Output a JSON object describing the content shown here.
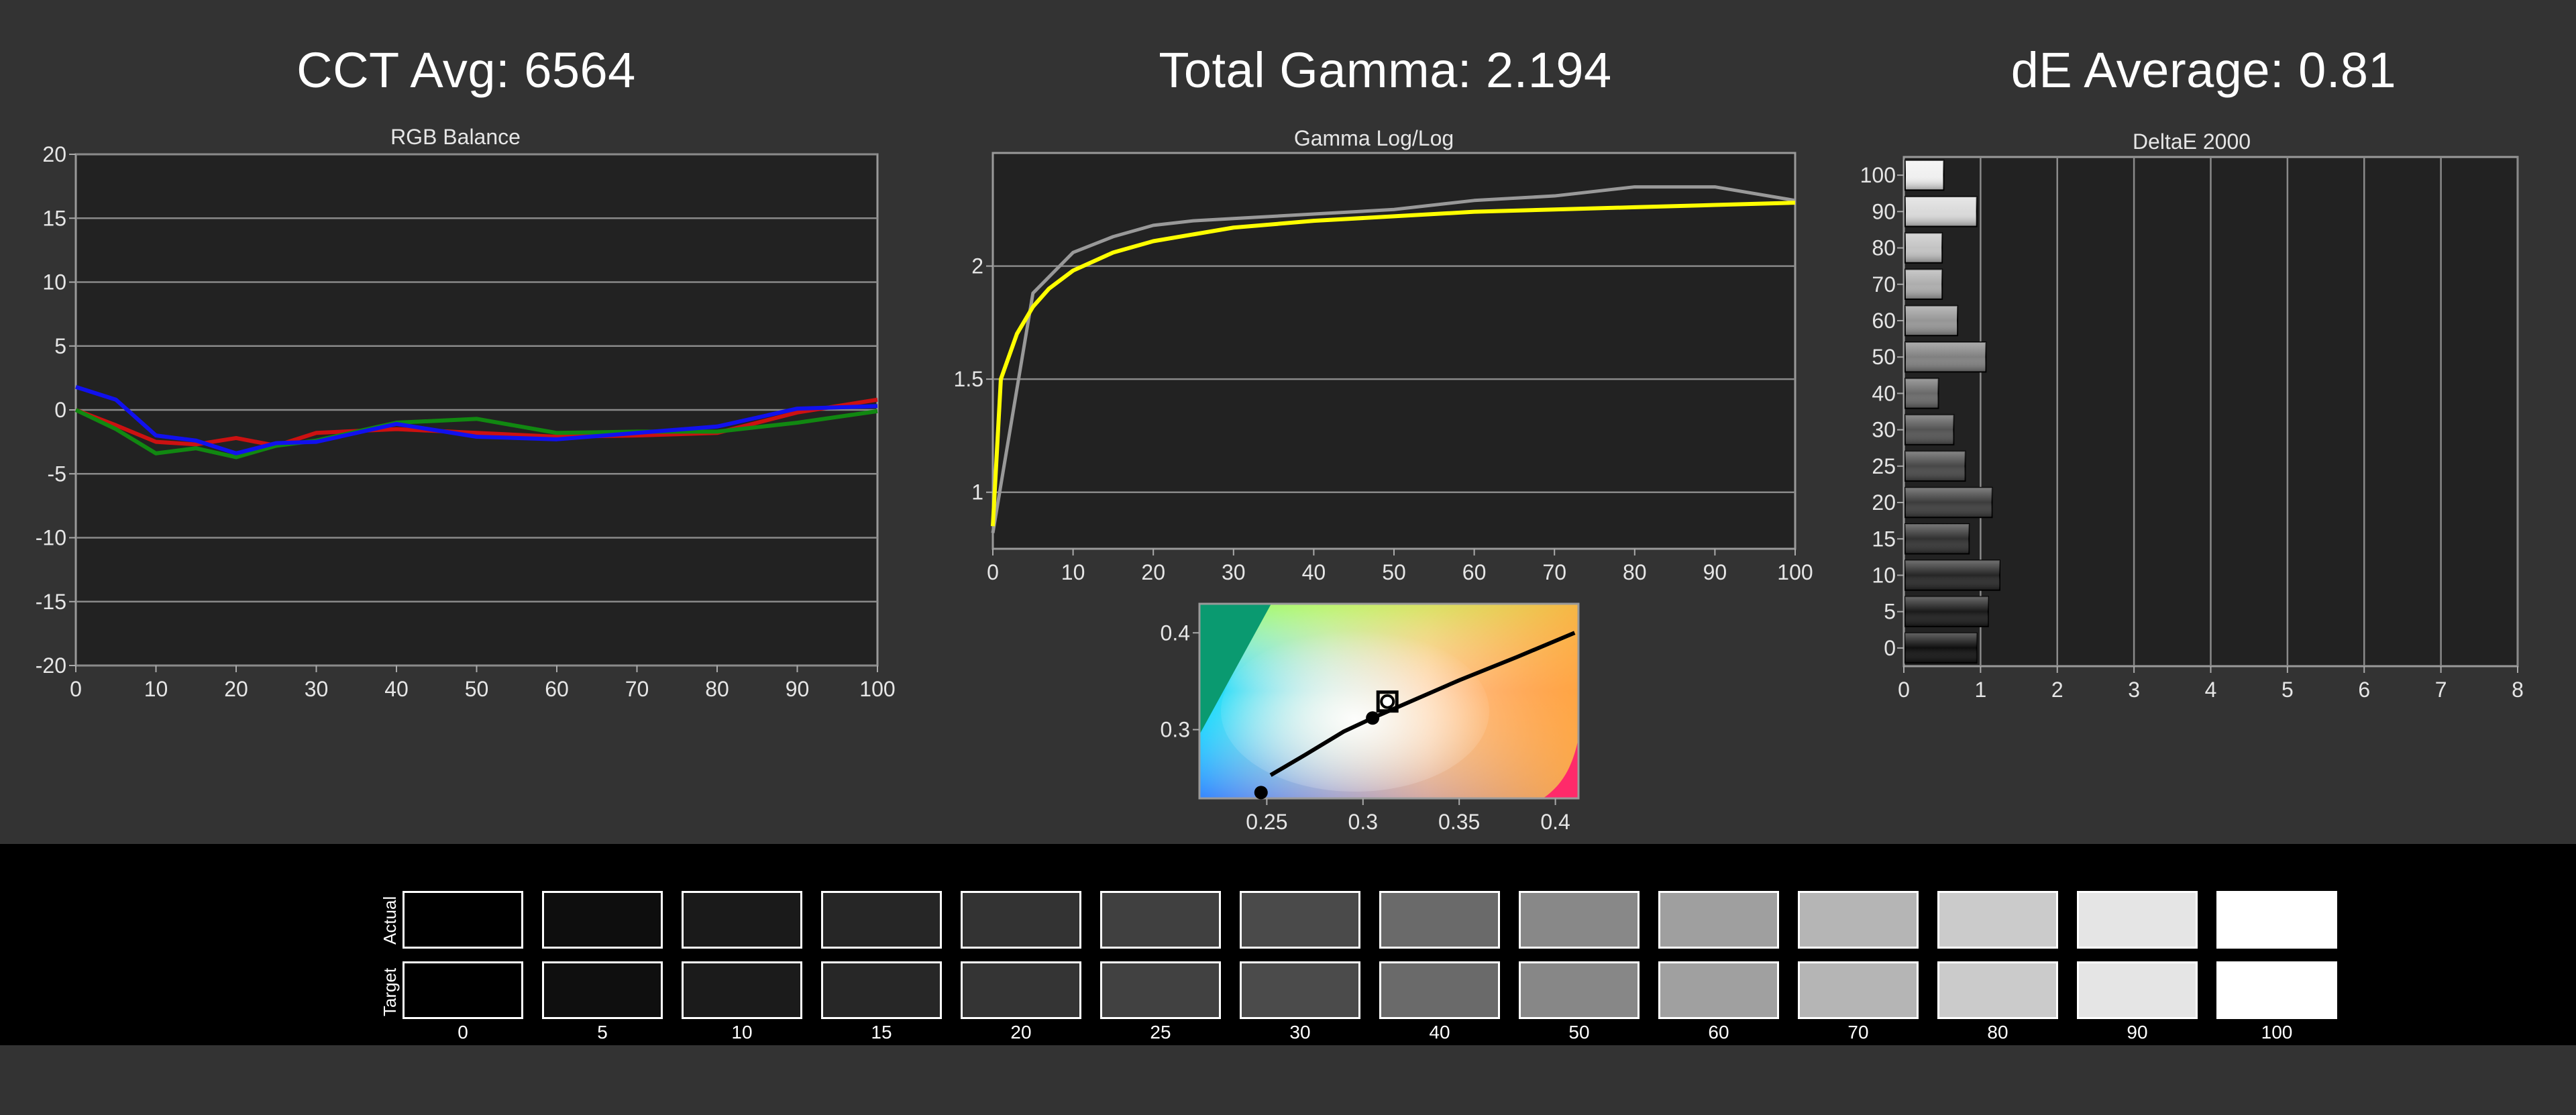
{
  "titles": {
    "cct": "CCT Avg: 6564",
    "gamma": "Total Gamma: 2.194",
    "de": "dE Average: 0.81"
  },
  "colors": {
    "background": "#333333",
    "plot_background": "#222222",
    "red": "#cc1111",
    "green": "#118811",
    "blue": "#1111ee",
    "gamma_measured": "#999999",
    "gamma_target": "#ffff00"
  },
  "chart_data": [
    {
      "type": "line",
      "title": "RGB Balance",
      "x": [
        0,
        5,
        10,
        15,
        20,
        25,
        30,
        40,
        50,
        60,
        70,
        80,
        90,
        100
      ],
      "xticks": [
        0,
        10,
        20,
        30,
        40,
        50,
        60,
        70,
        80,
        90,
        100
      ],
      "yticks": [
        20,
        15,
        10,
        5,
        0,
        -5,
        -10,
        -15,
        -20
      ],
      "xlim": [
        0,
        100
      ],
      "ylim": [
        -20,
        20
      ],
      "grid": true,
      "series": [
        {
          "color": "red",
          "values": [
            0,
            -1.2,
            -2.5,
            -2.7,
            -2.2,
            -2.8,
            -1.8,
            -1.5,
            -1.8,
            -2.1,
            -2.0,
            -1.8,
            -0.2,
            0.8
          ]
        },
        {
          "color": "green",
          "values": [
            0,
            -1.5,
            -3.4,
            -3.0,
            -3.7,
            -2.8,
            -2.4,
            -1.0,
            -0.7,
            -1.8,
            -1.7,
            -1.7,
            -1.0,
            -0.1
          ]
        },
        {
          "color": "blue",
          "values": [
            1.8,
            0.8,
            -2.0,
            -2.4,
            -3.4,
            -2.6,
            -2.5,
            -1.1,
            -2.1,
            -2.3,
            -1.8,
            -1.3,
            0.1,
            0.3
          ]
        }
      ]
    },
    {
      "type": "line",
      "title": "Gamma Log/Log",
      "xticks": [
        0,
        10,
        20,
        30,
        40,
        50,
        60,
        70,
        80,
        90,
        100
      ],
      "yticks": [
        "2",
        "1.5",
        "1"
      ],
      "xlim": [
        0,
        100
      ],
      "ylim": [
        0.75,
        2.5
      ],
      "grid": true,
      "series": [
        {
          "color": "gray",
          "x": [
            0,
            5,
            10,
            15,
            20,
            25,
            30,
            40,
            50,
            60,
            70,
            80,
            90,
            100
          ],
          "values": [
            0.82,
            1.88,
            2.06,
            2.13,
            2.18,
            2.2,
            2.21,
            2.23,
            2.25,
            2.29,
            2.31,
            2.35,
            2.35,
            2.29
          ]
        },
        {
          "color": "yellow",
          "x": [
            0,
            1,
            3,
            5,
            7,
            10,
            15,
            20,
            25,
            30,
            40,
            50,
            60,
            70,
            80,
            90,
            100
          ],
          "values": [
            0.85,
            1.5,
            1.7,
            1.82,
            1.9,
            1.98,
            2.06,
            2.11,
            2.14,
            2.17,
            2.2,
            2.22,
            2.24,
            2.25,
            2.26,
            2.27,
            2.28
          ]
        }
      ]
    },
    {
      "type": "scatter",
      "title": "",
      "xticks": [
        "0.25",
        "0.3",
        "0.35",
        "0.4"
      ],
      "yticks": [
        "0.4",
        "0.3"
      ],
      "xlim": [
        0.215,
        0.412
      ],
      "ylim": [
        0.229,
        0.43
      ],
      "curve": {
        "x": [
          0.252,
          0.27,
          0.29,
          0.305,
          0.32,
          0.35,
          0.38,
          0.41
        ],
        "values": [
          0.253,
          0.274,
          0.298,
          0.312,
          0.325,
          0.351,
          0.375,
          0.4
        ]
      },
      "points": [
        {
          "x": 0.247,
          "y": 0.235
        },
        {
          "x": 0.305,
          "y": 0.312
        }
      ],
      "target": {
        "x": 0.3127,
        "y": 0.329
      }
    },
    {
      "type": "bar",
      "orientation": "horizontal",
      "title": "DeltaE 2000",
      "categories": [
        "100",
        "90",
        "80",
        "70",
        "60",
        "50",
        "40",
        "30",
        "25",
        "20",
        "15",
        "10",
        "5",
        "0"
      ],
      "values": [
        0.52,
        0.95,
        0.5,
        0.5,
        0.7,
        1.07,
        0.45,
        0.65,
        0.8,
        1.15,
        0.85,
        1.25,
        1.1,
        0.95
      ],
      "xticks": [
        0,
        1,
        2,
        3,
        4,
        5,
        6,
        7,
        8
      ],
      "xlim": [
        0,
        8
      ],
      "grid": true
    }
  ],
  "swatches": {
    "actual_label": "Actual",
    "target_label": "Target",
    "levels": [
      "0",
      "5",
      "10",
      "15",
      "20",
      "25",
      "30",
      "40",
      "50",
      "60",
      "70",
      "80",
      "90",
      "100"
    ],
    "actual_colors": [
      "#000000",
      "#0e0e0e",
      "#1a1a1a",
      "#262626",
      "#333333",
      "#404040",
      "#4a4a4a",
      "#6a6a6a",
      "#888888",
      "#9f9f9f",
      "#b5b5b5",
      "#cbcbcb",
      "#e5e5e5",
      "#ffffff"
    ],
    "target_colors": [
      "#000000",
      "#0f0f0f",
      "#1b1b1b",
      "#272727",
      "#343434",
      "#414141",
      "#4b4b4b",
      "#6a6a6a",
      "#878787",
      "#a0a0a0",
      "#b5b5b5",
      "#cbcbcb",
      "#e5e5e5",
      "#ffffff"
    ]
  }
}
